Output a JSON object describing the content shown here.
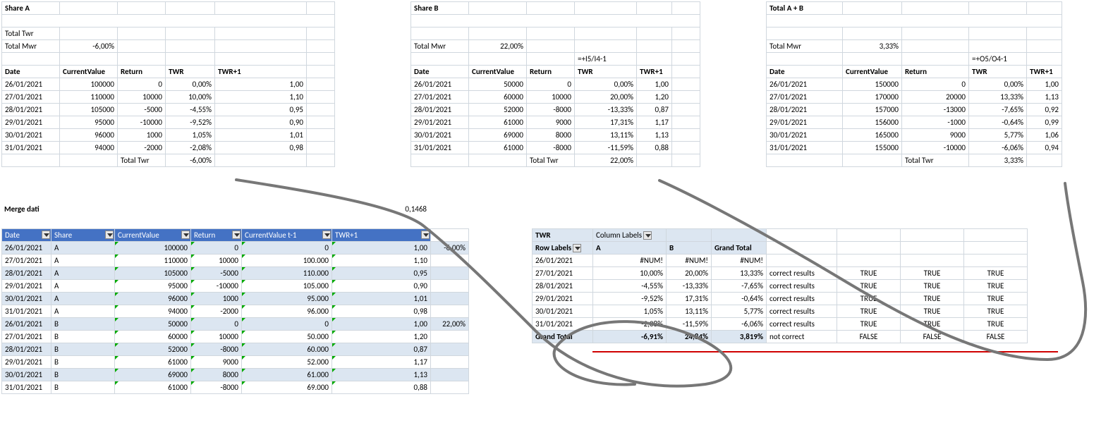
{
  "share_a": {
    "title": "Share A",
    "total_twr_label": "Total Twr",
    "total_mwr_label": "Total Mwr",
    "total_mwr": "-6,00%",
    "headers": [
      "Date",
      "CurrentValue",
      "Return",
      "TWR",
      "TWR+1"
    ],
    "rows": [
      [
        "26/01/2021",
        "100000",
        "0",
        "0,00%",
        "1,00"
      ],
      [
        "27/01/2021",
        "110000",
        "10000",
        "10,00%",
        "1,10"
      ],
      [
        "28/01/2021",
        "105000",
        "-5000",
        "-4,55%",
        "0,95"
      ],
      [
        "29/01/2021",
        "95000",
        "-10000",
        "-9,52%",
        "0,90"
      ],
      [
        "30/01/2021",
        "96000",
        "1000",
        "1,05%",
        "1,01"
      ],
      [
        "31/01/2021",
        "94000",
        "-2000",
        "-2,08%",
        "0,98"
      ]
    ],
    "total_twr_footer": "Total Twr",
    "total_twr_value": "-6,00%"
  },
  "share_b": {
    "title": "Share B",
    "total_mwr_label": "Total Mwr",
    "total_mwr": "22,00%",
    "formula_hint": "=+I5/I4-1",
    "headers": [
      "Date",
      "CurrentValue",
      "Return",
      "TWR",
      "TWR+1"
    ],
    "rows": [
      [
        "26/01/2021",
        "50000",
        "0",
        "0,00%",
        "1,00"
      ],
      [
        "27/01/2021",
        "60000",
        "10000",
        "20,00%",
        "1,20"
      ],
      [
        "28/01/2021",
        "52000",
        "-8000",
        "-13,33%",
        "0,87"
      ],
      [
        "29/01/2021",
        "61000",
        "9000",
        "17,31%",
        "1,17"
      ],
      [
        "30/01/2021",
        "69000",
        "8000",
        "13,11%",
        "1,13"
      ],
      [
        "31/01/2021",
        "61000",
        "-8000",
        "-11,59%",
        "0,88"
      ]
    ],
    "total_twr_footer": "Total Twr",
    "total_twr_value": "22,00%"
  },
  "total_ab": {
    "title": "Total A + B",
    "total_mwr_label": "Total Mwr",
    "total_mwr": "3,33%",
    "formula_hint": "=+O5/O4-1",
    "headers": [
      "Date",
      "CurrentValue",
      "Return",
      "TWR",
      "TWR+1"
    ],
    "rows": [
      [
        "26/01/2021",
        "150000",
        "0",
        "0,00%",
        "1,00"
      ],
      [
        "27/01/2021",
        "170000",
        "20000",
        "13,33%",
        "1,13"
      ],
      [
        "28/01/2021",
        "157000",
        "-13000",
        "-7,65%",
        "0,92"
      ],
      [
        "29/01/2021",
        "156000",
        "-1000",
        "-0,64%",
        "0,99"
      ],
      [
        "30/01/2021",
        "165000",
        "9000",
        "5,77%",
        "1,06"
      ],
      [
        "31/01/2021",
        "155000",
        "-10000",
        "-6,06%",
        "0,94"
      ]
    ],
    "total_twr_footer": "Total Twr",
    "total_twr_value": "3,33%"
  },
  "merge": {
    "title": "Merge dati",
    "side_value": "0,1468",
    "headers": [
      "Date",
      "Share",
      "CurrentValue",
      "Return",
      "CurrentValue t-1",
      "TWR+1"
    ],
    "side_col": [
      "-6,00%",
      "",
      "",
      "",
      "",
      "",
      "22,00%",
      "",
      "",
      "",
      "",
      ""
    ],
    "rows": [
      [
        "26/01/2021",
        "A",
        "100000",
        "0",
        "0",
        "1,00"
      ],
      [
        "27/01/2021",
        "A",
        "110000",
        "10000",
        "100.000",
        "1,10"
      ],
      [
        "28/01/2021",
        "A",
        "105000",
        "-5000",
        "110.000",
        "0,95"
      ],
      [
        "29/01/2021",
        "A",
        "95000",
        "-10000",
        "105.000",
        "0,90"
      ],
      [
        "30/01/2021",
        "A",
        "96000",
        "1000",
        "95.000",
        "1,01"
      ],
      [
        "31/01/2021",
        "A",
        "94000",
        "-2000",
        "96.000",
        "0,98"
      ],
      [
        "26/01/2021",
        "B",
        "50000",
        "0",
        "0",
        "1,00"
      ],
      [
        "27/01/2021",
        "B",
        "60000",
        "10000",
        "50.000",
        "1,20"
      ],
      [
        "28/01/2021",
        "B",
        "52000",
        "-8000",
        "60.000",
        "0,87"
      ],
      [
        "29/01/2021",
        "B",
        "61000",
        "9000",
        "52.000",
        "1,17"
      ],
      [
        "30/01/2021",
        "B",
        "69000",
        "8000",
        "61.000",
        "1,13"
      ],
      [
        "31/01/2021",
        "B",
        "61000",
        "-8000",
        "69.000",
        "0,88"
      ]
    ]
  },
  "pivot": {
    "twr_label": "TWR",
    "col_labels": "Column Labels",
    "row_labels": "Row Labels",
    "cols": [
      "A",
      "B",
      "Grand Total"
    ],
    "rows": [
      [
        "26/01/2021",
        "#NUM!",
        "#NUM!",
        "#NUM!",
        "",
        "",
        "",
        ""
      ],
      [
        "27/01/2021",
        "10,00%",
        "20,00%",
        "13,33%",
        "correct results",
        "TRUE",
        "TRUE",
        "TRUE"
      ],
      [
        "28/01/2021",
        "-4,55%",
        "-13,33%",
        "-7,65%",
        "correct results",
        "TRUE",
        "TRUE",
        "TRUE"
      ],
      [
        "29/01/2021",
        "-9,52%",
        "17,31%",
        "-0,64%",
        "correct results",
        "TRUE",
        "TRUE",
        "TRUE"
      ],
      [
        "30/01/2021",
        "1,05%",
        "13,11%",
        "5,77%",
        "correct results",
        "TRUE",
        "TRUE",
        "TRUE"
      ],
      [
        "31/01/2021",
        "-2,08%",
        "-11,59%",
        "-6,06%",
        "correct results",
        "TRUE",
        "TRUE",
        "TRUE"
      ]
    ],
    "grand_total_label": "Grand Total",
    "grand_total": [
      "-6,91%",
      "24,84%",
      "3,819%",
      "not correct",
      "FALSE",
      "FALSE",
      "FALSE"
    ]
  }
}
